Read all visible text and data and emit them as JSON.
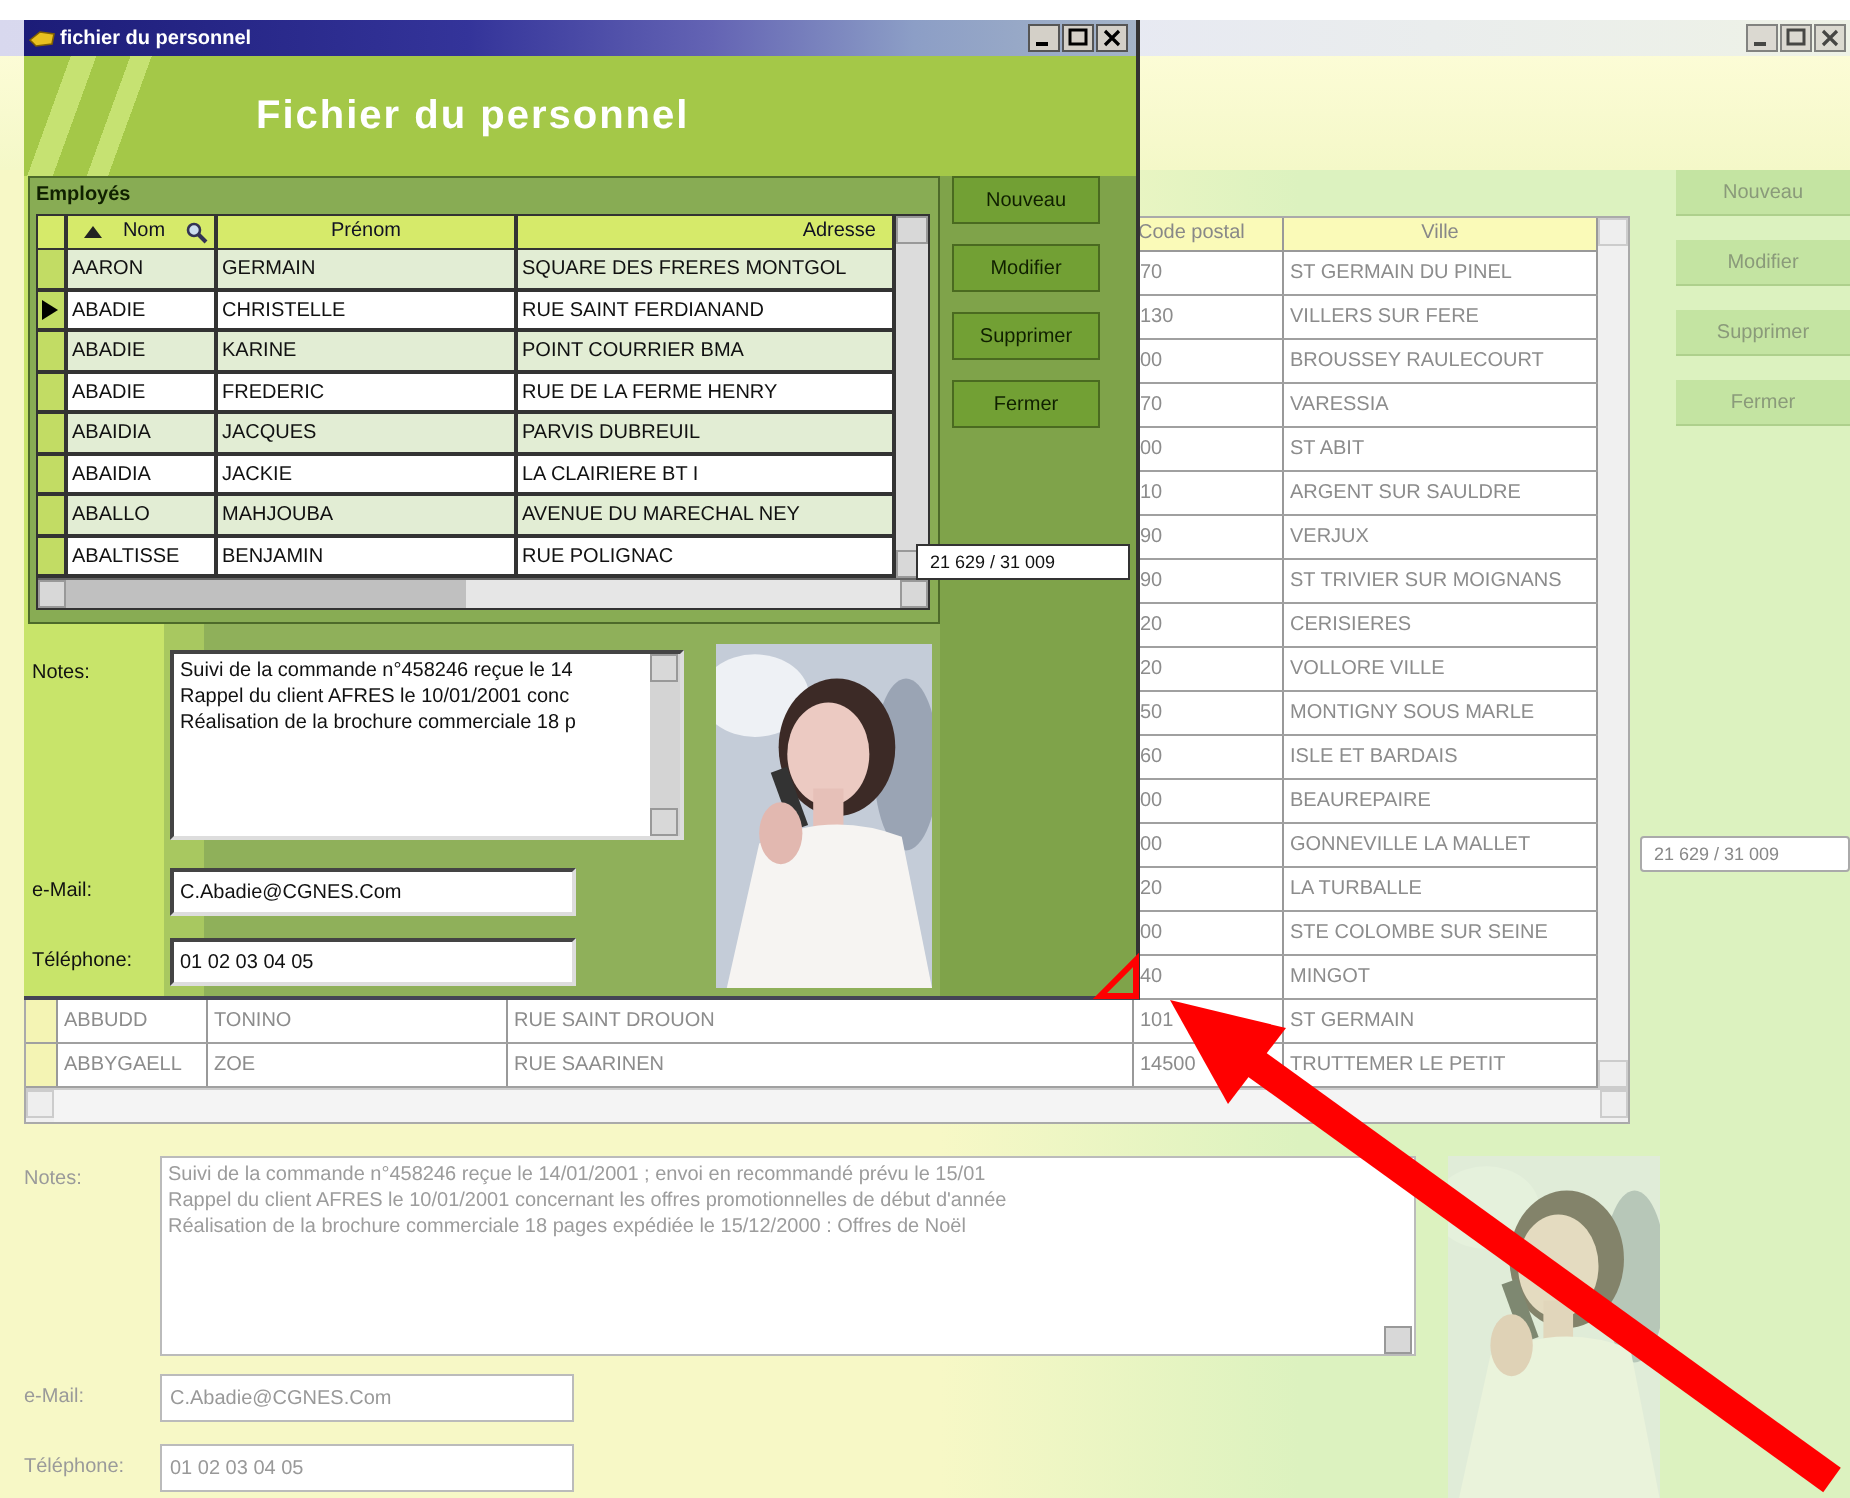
{
  "background_window": {
    "columns": [
      "Code postal",
      "Ville"
    ],
    "rows": [
      {
        "code_postal": "70",
        "ville": "ST GERMAIN DU PINEL"
      },
      {
        "code_postal": "130",
        "ville": "VILLERS SUR FERE"
      },
      {
        "code_postal": "00",
        "ville": "BROUSSEY RAULECOURT"
      },
      {
        "code_postal": "70",
        "ville": "VARESSIA"
      },
      {
        "code_postal": "00",
        "ville": "ST ABIT"
      },
      {
        "code_postal": "10",
        "ville": "ARGENT SUR SAULDRE"
      },
      {
        "code_postal": "90",
        "ville": "VERJUX"
      },
      {
        "code_postal": "90",
        "ville": "ST TRIVIER SUR MOIGNANS"
      },
      {
        "code_postal": "20",
        "ville": "CERISIERES"
      },
      {
        "code_postal": "20",
        "ville": "VOLLORE VILLE"
      },
      {
        "code_postal": "50",
        "ville": "MONTIGNY SOUS MARLE"
      },
      {
        "code_postal": "60",
        "ville": "ISLE ET BARDAIS"
      },
      {
        "code_postal": "00",
        "ville": "BEAUREPAIRE"
      },
      {
        "code_postal": "00",
        "ville": "GONNEVILLE LA MALLET"
      },
      {
        "code_postal": "20",
        "ville": "LA TURBALLE"
      },
      {
        "code_postal": "00",
        "ville": "STE COLOMBE SUR SEINE"
      },
      {
        "code_postal": "40",
        "ville": "MINGOT"
      },
      {
        "nom": "ABBUDD",
        "prenom": "TONINO",
        "adresse": "RUE SAINT DROUON",
        "code_postal": "101",
        "ville": "ST GERMAIN"
      },
      {
        "nom": "ABBYGAELL",
        "prenom": "ZOE",
        "adresse": "RUE SAARINEN",
        "code_postal": "14500",
        "ville": "TRUTTEMER LE PETIT"
      }
    ],
    "record_count": "21 629 / 31 009",
    "buttons": [
      "Nouveau",
      "Modifier",
      "Supprimer",
      "Fermer"
    ],
    "form": {
      "notes_label": "Notes:",
      "notes": [
        "Suivi de la commande n°458246 reçue le 14/01/2001 ; envoi en recommandé prévu le 15/01",
        "Rappel du client AFRES le 10/01/2001 concernant les offres promotionnelles de début d'année",
        "Réalisation de la brochure commerciale 18 pages expédiée le 15/12/2000 : Offres de Noël"
      ],
      "email_label": "e-Mail:",
      "email": "C.Abadie@CGNES.Com",
      "phone_label": "Téléphone:",
      "phone": "01 02 03 04 05"
    }
  },
  "window": {
    "title": "fichier du personnel",
    "heading": "Fichier du personnel",
    "panel_title": "Employés",
    "columns": [
      "Nom",
      "Prénom",
      "Adresse"
    ],
    "rows": [
      {
        "nom": "AARON",
        "prenom": "GERMAIN",
        "adresse": "SQUARE DES FRERES MONTGOL",
        "selected": false
      },
      {
        "nom": "ABADIE",
        "prenom": "CHRISTELLE",
        "adresse": "RUE SAINT FERDIANAND",
        "selected": true
      },
      {
        "nom": "ABADIE",
        "prenom": "KARINE",
        "adresse": "POINT COURRIER BMA",
        "selected": false
      },
      {
        "nom": "ABADIE",
        "prenom": "FREDERIC",
        "adresse": "RUE DE LA FERME HENRY",
        "selected": false
      },
      {
        "nom": "ABAIDIA",
        "prenom": "JACQUES",
        "adresse": "PARVIS DUBREUIL",
        "selected": false
      },
      {
        "nom": "ABAIDIA",
        "prenom": "JACKIE",
        "adresse": "LA CLAIRIERE BT I",
        "selected": false
      },
      {
        "nom": "ABALLO",
        "prenom": "MAHJOUBA",
        "adresse": "AVENUE DU MARECHAL NEY",
        "selected": false
      },
      {
        "nom": "ABALTISSE",
        "prenom": "BENJAMIN",
        "adresse": "RUE POLIGNAC",
        "selected": false
      }
    ],
    "record_count": "21 629 / 31 009",
    "buttons": [
      "Nouveau",
      "Modifier",
      "Supprimer",
      "Fermer"
    ],
    "form": {
      "notes_label": "Notes:",
      "notes": [
        "Suivi de la commande n°458246 reçue le 14",
        "Rappel du client AFRES le 10/01/2001 conc",
        "Réalisation de la brochure commerciale 18 p"
      ],
      "email_label": "e-Mail:",
      "email": "C.Abadie@CGNES.Com",
      "phone_label": "Téléphone:",
      "phone": "01 02 03 04 05"
    }
  }
}
